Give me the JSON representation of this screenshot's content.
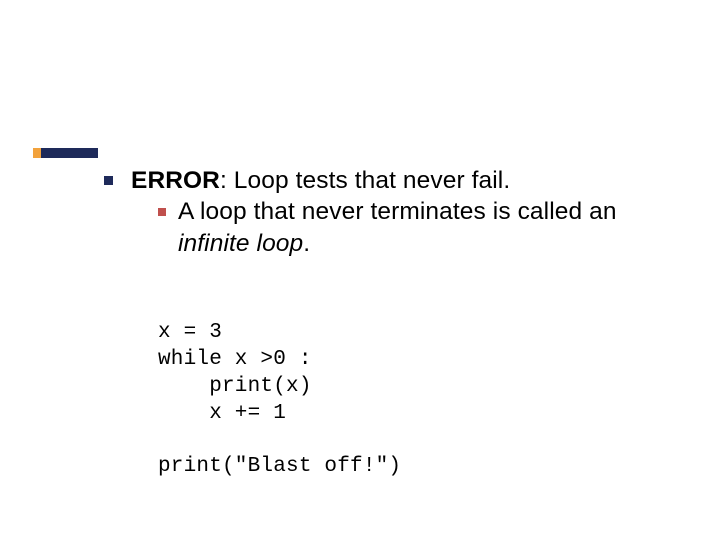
{
  "main": {
    "line1_bold": "ERROR",
    "line1_rest": ": Loop tests that never fail.",
    "sub_part1": "A loop that never terminates is called an ",
    "sub_italic": "infinite loop",
    "sub_part2": "."
  },
  "code": {
    "l1": "x = 3",
    "l2": "while x >0 :",
    "l3": "    print(x)",
    "l4": "    x += 1",
    "blank": "",
    "l5": "print(\"Blast off!\")"
  }
}
